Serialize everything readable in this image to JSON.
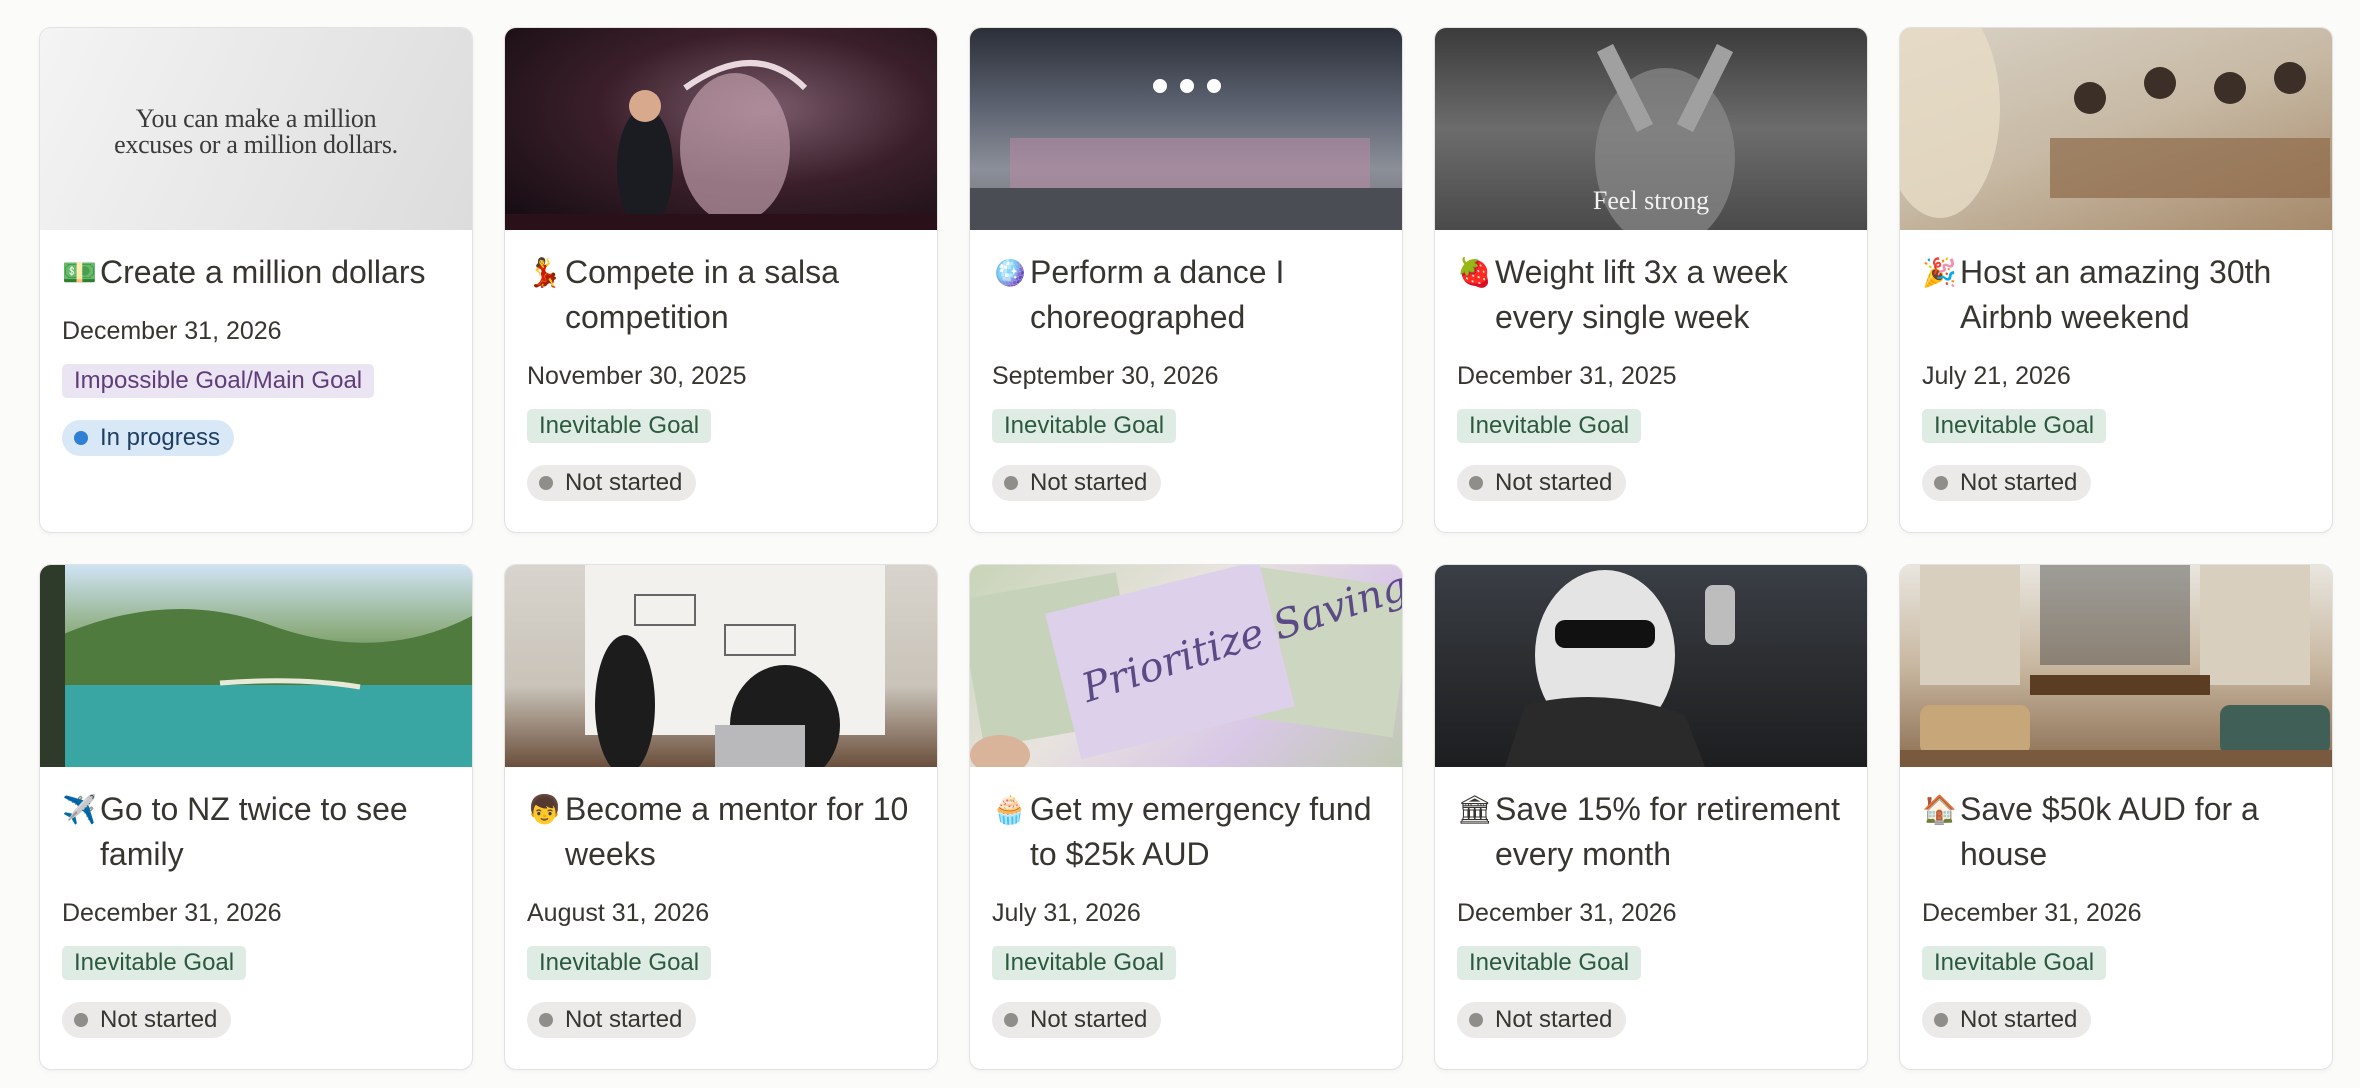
{
  "cards": [
    {
      "icon": "money-icon",
      "emoji": "💵",
      "title": "Create a million dollars",
      "date": "December 31, 2026",
      "tag": "Impossible Goal/Main Goal",
      "tag_kind": "impossible",
      "status": "In progress",
      "status_kind": "in-progress",
      "cover_quote": "You can make a million excuses or a million dollars.",
      "cover": "c1"
    },
    {
      "icon": "dancer-icon",
      "emoji": "💃",
      "title": "Compete in a salsa competition",
      "date": "November 30, 2025",
      "tag": "Inevitable Goal",
      "tag_kind": "inevitable",
      "status": "Not started",
      "status_kind": "not-started",
      "cover": "c2"
    },
    {
      "icon": "disco-ball-icon",
      "emoji": "🪩",
      "title": "Perform a dance I choreographed",
      "date": "September 30, 2026",
      "tag": "Inevitable Goal",
      "tag_kind": "inevitable",
      "status": "Not started",
      "status_kind": "not-started",
      "cover": "c3"
    },
    {
      "icon": "strawberry-icon",
      "emoji": "🍓",
      "title": "Weight lift 3x a week every single week",
      "date": "December 31, 2025",
      "tag": "Inevitable Goal",
      "tag_kind": "inevitable",
      "status": "Not started",
      "status_kind": "not-started",
      "cover_overlay": "Feel strong",
      "cover": "c4"
    },
    {
      "icon": "party-popper-icon",
      "emoji": "🎉",
      "title": "Host an amazing 30th Airbnb weekend",
      "date": "July 21, 2026",
      "tag": "Inevitable Goal",
      "tag_kind": "inevitable",
      "status": "Not started",
      "status_kind": "not-started",
      "cover": "c5"
    },
    {
      "icon": "airplane-icon",
      "emoji": "✈️",
      "title": "Go to NZ twice to see family",
      "date": "December 31, 2026",
      "tag": "Inevitable Goal",
      "tag_kind": "inevitable",
      "status": "Not started",
      "status_kind": "not-started",
      "cover": "c6"
    },
    {
      "icon": "person-icon",
      "emoji": "👦",
      "title": "Become a mentor for 10 weeks",
      "date": "August 31, 2026",
      "tag": "Inevitable Goal",
      "tag_kind": "inevitable",
      "status": "Not started",
      "status_kind": "not-started",
      "cover": "c7"
    },
    {
      "icon": "cake-icon",
      "emoji": "🧁",
      "title": "Get my emergency fund to $25k AUD",
      "date": "July 31, 2026",
      "tag": "Inevitable Goal",
      "tag_kind": "inevitable",
      "status": "Not started",
      "status_kind": "not-started",
      "cover_art": "Prioritize Savings",
      "cover": "c8"
    },
    {
      "icon": "bank-icon",
      "emoji": "🏛",
      "title": "Save 15% for retirement every month",
      "date": "December 31, 2026",
      "tag": "Inevitable Goal",
      "tag_kind": "inevitable",
      "status": "Not started",
      "status_kind": "not-started",
      "cover": "c9"
    },
    {
      "icon": "house-icon",
      "emoji": "🏠",
      "title": "Save $50k AUD for a house",
      "date": "December 31, 2026",
      "tag": "Inevitable Goal",
      "tag_kind": "inevitable",
      "status": "Not started",
      "status_kind": "not-started",
      "cover": "c10"
    }
  ]
}
